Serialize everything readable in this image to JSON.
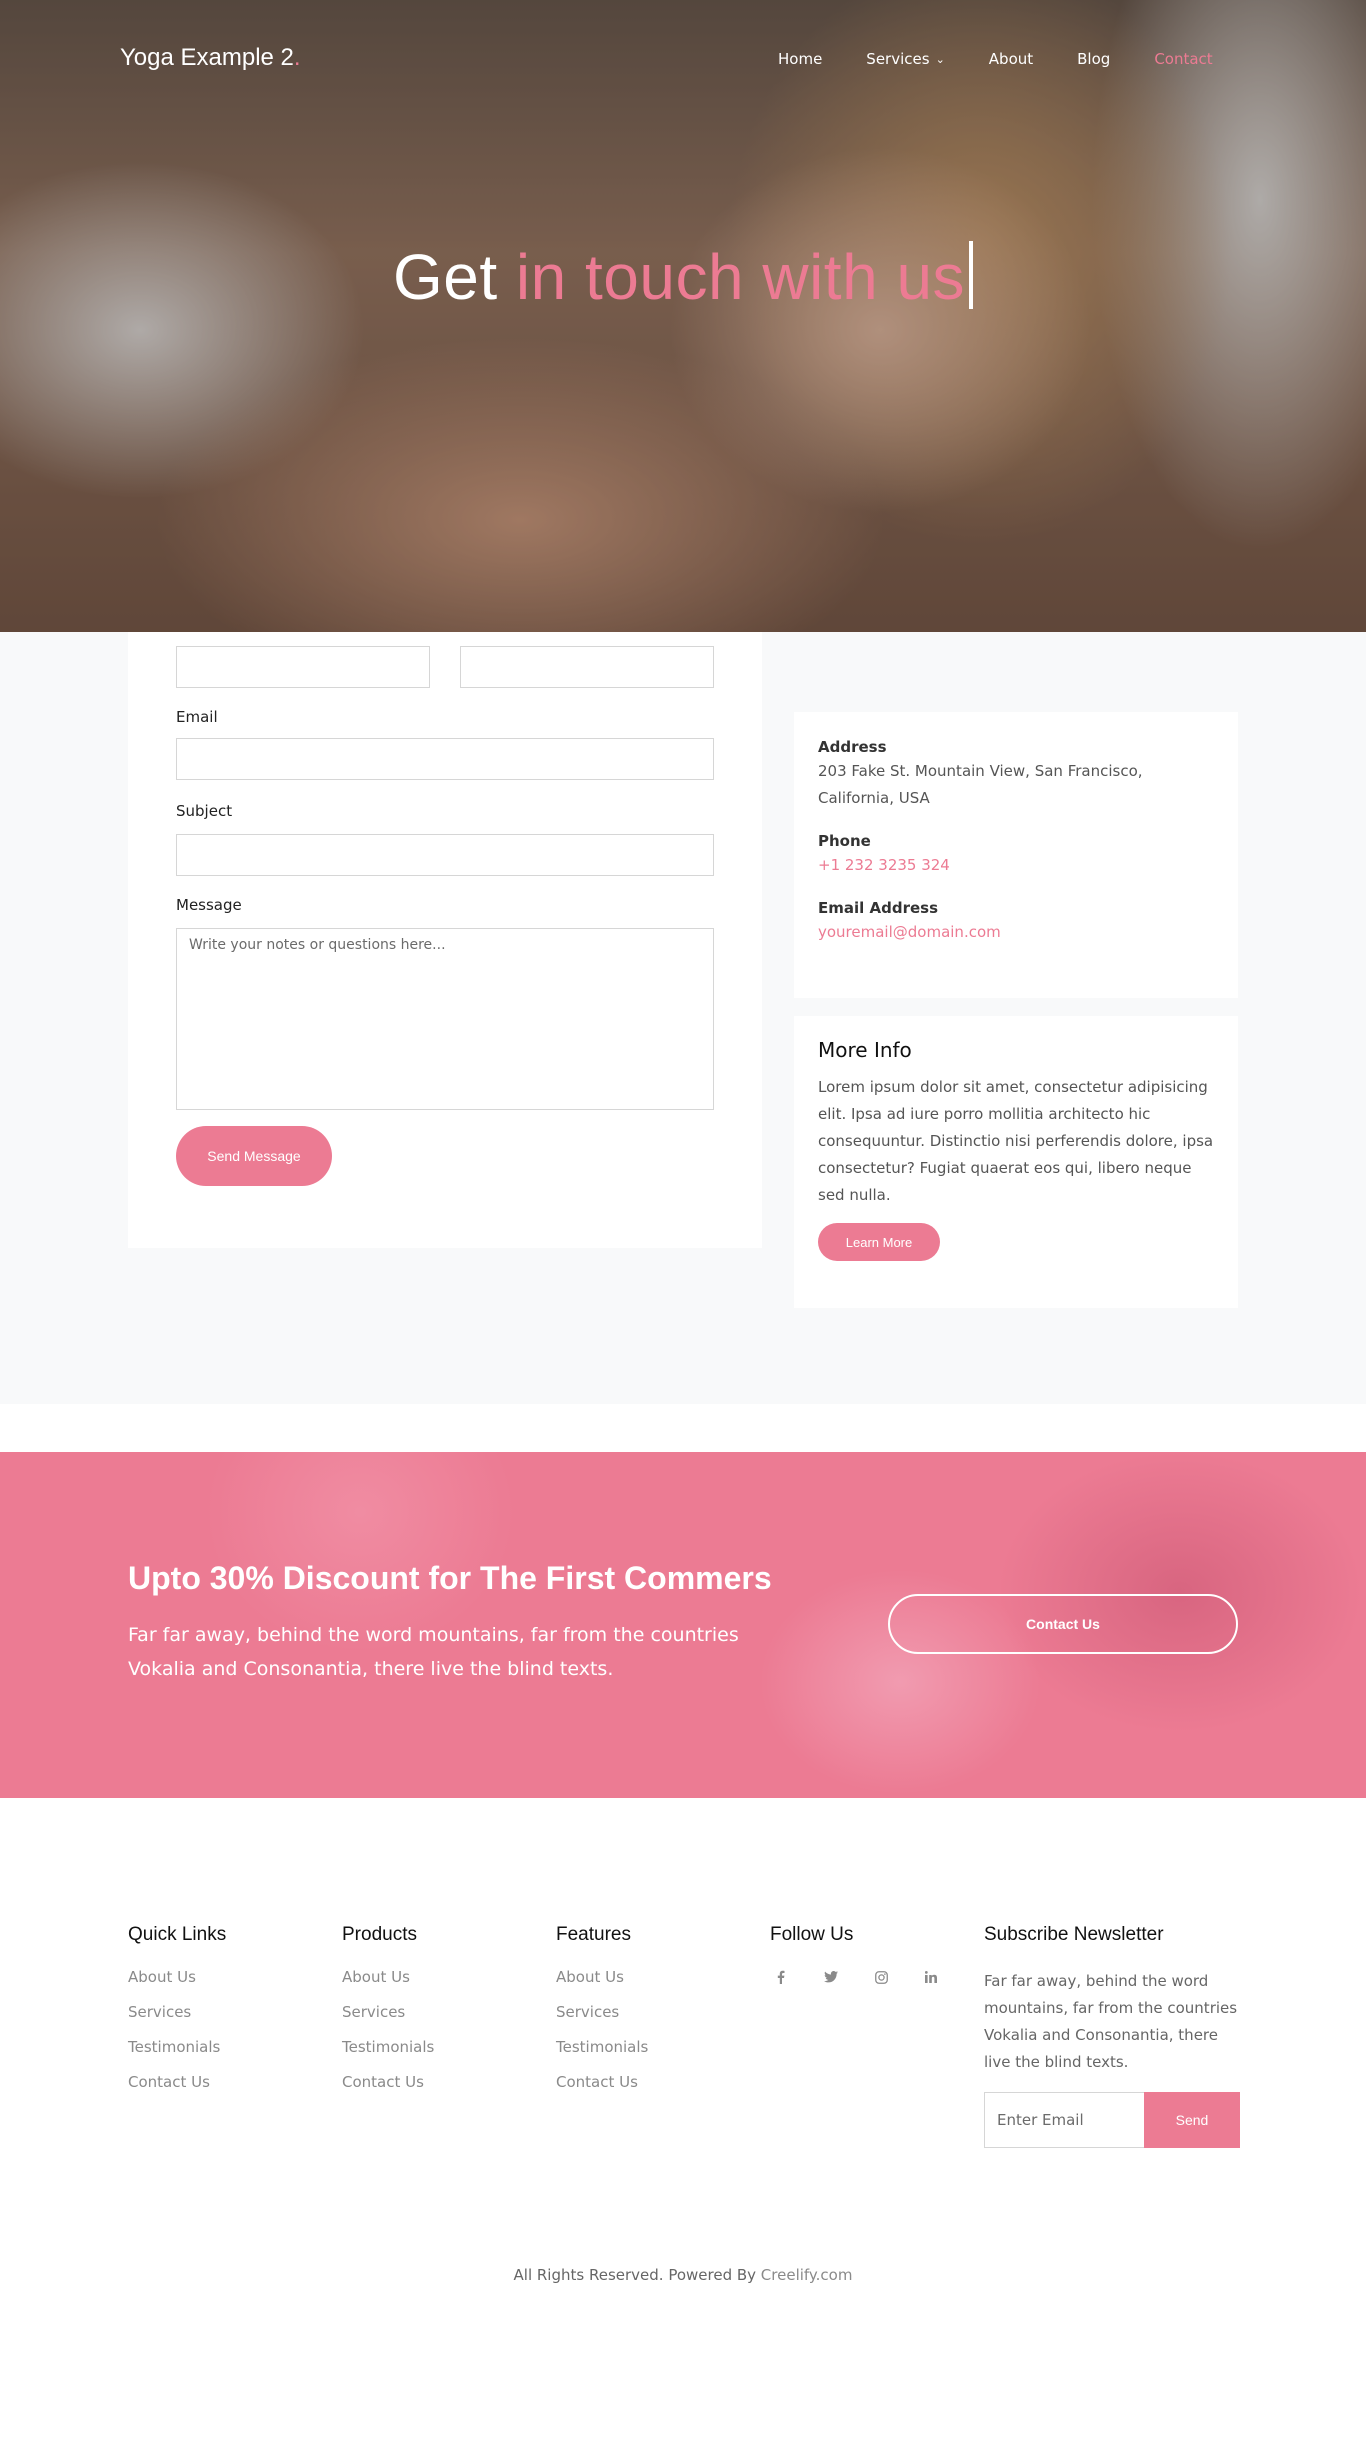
{
  "header": {
    "logo": "Yoga Example 2",
    "logo_dot": ".",
    "nav": [
      {
        "label": "Home"
      },
      {
        "label": "Services"
      },
      {
        "label": "About"
      },
      {
        "label": "Blog"
      },
      {
        "label": "Contact"
      }
    ]
  },
  "hero": {
    "title_prefix": "Get ",
    "title_accent": "in touch with us"
  },
  "form": {
    "email_label": "Email",
    "subject_label": "Subject",
    "message_label": "Message",
    "message_placeholder": "Write your notes or questions here...",
    "send_label": "Send Message"
  },
  "contact_info": {
    "address_label": "Address",
    "address_value": "203 Fake St. Mountain View, San Francisco, California, USA",
    "phone_label": "Phone",
    "phone_value": "+1 232 3235 324",
    "email_label": "Email Address",
    "email_value": "youremail@domain.com"
  },
  "more_info": {
    "title": "More Info",
    "text": "Lorem ipsum dolor sit amet, consectetur adipisicing elit. Ipsa ad iure porro mollitia architecto hic consequuntur. Distinctio nisi perferendis dolore, ipsa consectetur? Fugiat quaerat eos qui, libero neque sed nulla.",
    "button": "Learn More"
  },
  "promo": {
    "title": "Upto 30% Discount for The First Commers",
    "text": "Far far away, behind the word mountains, far from the countries Vokalia and Consonantia, there live the blind texts.",
    "button": "Contact Us"
  },
  "footer": {
    "quick_links": {
      "title": "Quick Links",
      "items": [
        "About Us",
        "Services",
        "Testimonials",
        "Contact Us"
      ]
    },
    "products": {
      "title": "Products",
      "items": [
        "About Us",
        "Services",
        "Testimonials",
        "Contact Us"
      ]
    },
    "features": {
      "title": "Features",
      "items": [
        "About Us",
        "Services",
        "Testimonials",
        "Contact Us"
      ]
    },
    "follow": {
      "title": "Follow Us",
      "icons": [
        "facebook-icon",
        "twitter-icon",
        "instagram-icon",
        "linkedin-icon"
      ]
    },
    "newsletter": {
      "title": "Subscribe Newsletter",
      "text": "Far far away, behind the word mountains, far from the countries Vokalia and Consonantia, there live the blind texts.",
      "placeholder": "Enter Email",
      "button": "Send"
    },
    "copyright_prefix": "All Rights Reserved. Powered By ",
    "copyright_link": "Creelify.com"
  },
  "colors": {
    "accent": "#ec7b93",
    "section_bg": "#f8f9fa"
  }
}
